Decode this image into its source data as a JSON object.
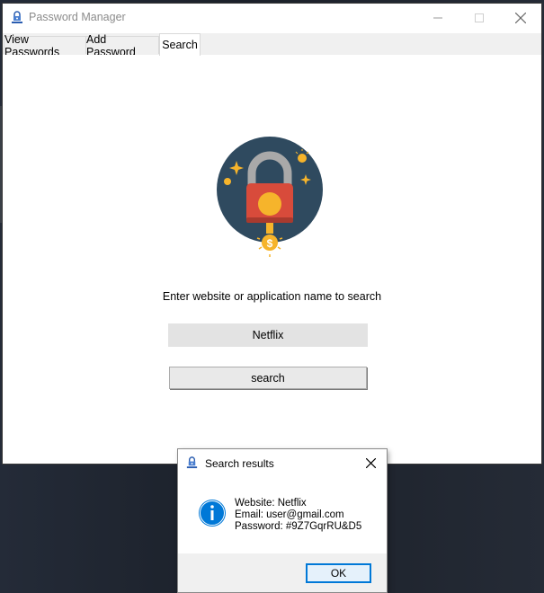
{
  "window": {
    "title": "Password Manager",
    "icon": "lock-person-icon"
  },
  "tabs": [
    {
      "label": "View Passwords",
      "active": false
    },
    {
      "label": "Add Password",
      "active": false
    },
    {
      "label": "Search",
      "active": true
    }
  ],
  "search_page": {
    "logo": "padlock-coin-icon",
    "prompt": "Enter website or application name to search",
    "input_value": "Netflix",
    "button_label": "search"
  },
  "dialog": {
    "title": "Search results",
    "icon": "info-icon",
    "lines": [
      "Website: Netflix",
      "Email: user@gmail.com",
      "Password: #9Z7GqrRU&D5"
    ],
    "ok_label": "OK"
  },
  "colors": {
    "accent": "#0078d7",
    "logo_circle": "#2f4a5f",
    "lock_body": "#d84b3b",
    "gold": "#f6b42b"
  }
}
